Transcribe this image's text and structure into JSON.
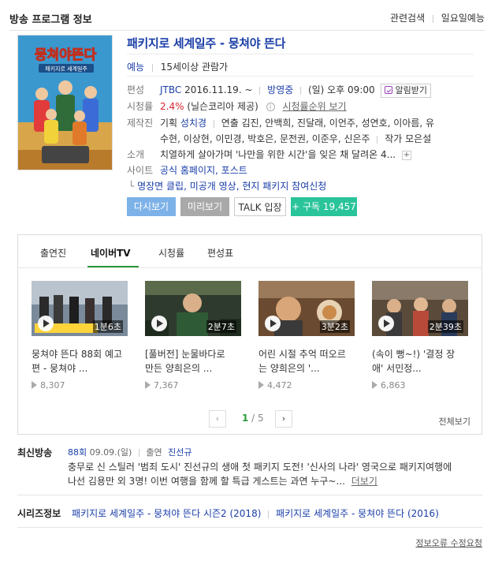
{
  "header": {
    "title": "방송 프로그램 정보",
    "links": [
      "관련검색",
      "일요일예능"
    ]
  },
  "show": {
    "title": "패키지로 세계일주 - 뭉쳐야 뜬다",
    "genre": "예능",
    "rating_age": "15세이상 관람가",
    "poster_title": "뭉쳐야뜬다",
    "poster_subtitle": "패키지로 세계일주"
  },
  "details": {
    "schedule_label": "편성",
    "channel": "JTBC",
    "start_date": "2016.11.19. ~",
    "status": "방영중",
    "time": "(일) 오후 09:00",
    "alarm_label": "알림받기",
    "rating_label": "시청률",
    "rating_value": "2.4%",
    "rating_source": "(닐슨코리아 제공)",
    "rating_rank_link": "시청률순위 보기",
    "staff_label": "제작진",
    "staff_line1_prefix": "기획",
    "staff_planner": "성치경",
    "staff_line1_rest": "연출 김진, 안백희, 진달래, 이언주, 성연호, 이아름, 유",
    "staff_line2": "수현, 이상현, 이민경, 박호은, 문전권, 이준우, 신은주",
    "staff_line2_tail": "작가 모은설",
    "summary_label": "소개",
    "summary": "치열하게 살아가며 '나만을 위한 시간'을 잊은 채 달려온 4...",
    "summary_more": "+",
    "site_label": "사이트",
    "site_links": "공식 홈페이지, 포스트",
    "extra_links": "명장면 클립, 미공개 영상, 현지 패키지 참여신청"
  },
  "buttons": {
    "rewatch": "다시보기",
    "preview": "미리보기",
    "talk": "TALK 입장",
    "subscribe": "+ 구독 19,457"
  },
  "tabs": [
    "출연진",
    "네이버TV",
    "시청률",
    "편성표"
  ],
  "clips": [
    {
      "title_line1": "뭉쳐야 뜬다 88회 예고",
      "title_line2": "편 - 뭉쳐야 ...",
      "duration": "1분6초",
      "views": "8,307"
    },
    {
      "title_line1": "[풀버전] 눈물바다로",
      "title_line2": "만든 양희은의 ...",
      "duration": "2분7초",
      "views": "7,367"
    },
    {
      "title_line1": "어린 시절 추억 떠오르",
      "title_line2": "는 양희은의 '...",
      "duration": "3분2초",
      "views": "4,472"
    },
    {
      "title_line1": "(속이 뻥~!) '결정 장",
      "title_line2": "애' 서민정...",
      "duration": "2분39초",
      "views": "6,863"
    }
  ],
  "pager": {
    "current": "1",
    "separator": " / ",
    "total": "5",
    "view_all": "전체보기"
  },
  "latest": {
    "label": "최신방송",
    "episode": "88회",
    "date": "09.09.(일)",
    "cast_label": "출연",
    "cast": "진선규",
    "desc_line1": "충무로 신 스틸러 '범죄 도시' 진선규의 생애 첫 패키지 도전! '신사의 나라' 영국으로 패키지여행에",
    "desc_line2": "나선 김용만 외 3명! 이번 여행을 함께 할 특급 게스트는 과연 누구~...",
    "more": "더보기"
  },
  "series": {
    "label": "시리즈정보",
    "items": [
      "패키지로 세계일주 - 뭉쳐야 뜬다 시즌2 (2018)",
      "패키지로 세계일주 - 뭉쳐야 뜬다 (2016)"
    ]
  },
  "footer": {
    "report": "정보오류 수정요청"
  },
  "colors": {
    "link_blue": "#1a3ea8",
    "accent_green": "#2a9a3a",
    "rating_red": "#d6262e",
    "subscribe_green": "#2ac49a",
    "rewatch_blue": "#7db2e8"
  }
}
